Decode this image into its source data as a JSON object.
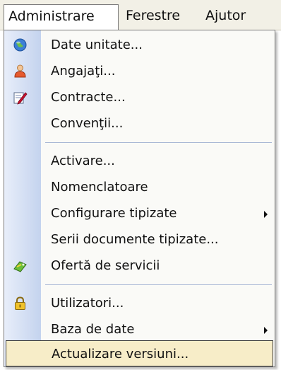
{
  "menubar": {
    "items": [
      {
        "label": "Administrare"
      },
      {
        "label": "Ferestre"
      },
      {
        "label": "Ajutor"
      }
    ]
  },
  "menu": {
    "items": [
      {
        "label": "Date unitate...",
        "icon": "globe-icon"
      },
      {
        "label": "Angajaţi...",
        "icon": "users-icon"
      },
      {
        "label": "Contracte...",
        "icon": "document-edit-icon"
      },
      {
        "label": "Convenţii...",
        "icon": ""
      },
      {
        "label": "Activare...",
        "icon": ""
      },
      {
        "label": "Nomenclatoare",
        "icon": ""
      },
      {
        "label": "Configurare tipizate",
        "icon": "",
        "submenu": true
      },
      {
        "label": "Serii documente tipizate...",
        "icon": ""
      },
      {
        "label": "Ofertă de servicii",
        "icon": "offer-icon"
      },
      {
        "label": "Utilizatori...",
        "icon": "lock-icon"
      },
      {
        "label": "Baza de date",
        "icon": "",
        "submenu": true
      },
      {
        "label": "Actualizare versiuni...",
        "icon": "",
        "highlighted": true
      }
    ]
  },
  "colors": {
    "menubar_bg": "#f2f0e6",
    "icon_strip_light": "#e8eefa",
    "icon_strip_dark": "#c4d3ee",
    "highlight_bg": "#f7edc8",
    "separator": "#a9b8d6"
  }
}
